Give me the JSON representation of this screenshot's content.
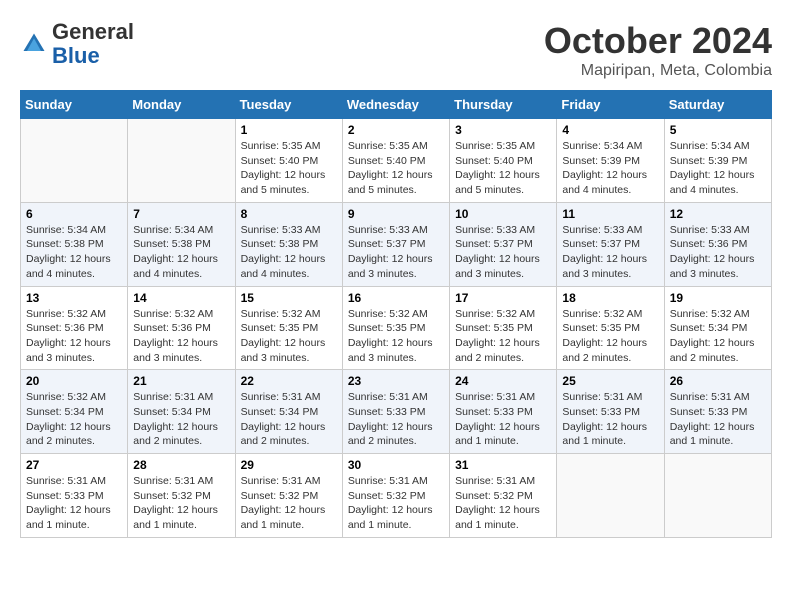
{
  "header": {
    "logo_general": "General",
    "logo_blue": "Blue",
    "month": "October 2024",
    "location": "Mapiripan, Meta, Colombia"
  },
  "days_of_week": [
    "Sunday",
    "Monday",
    "Tuesday",
    "Wednesday",
    "Thursday",
    "Friday",
    "Saturday"
  ],
  "weeks": [
    [
      {
        "day": "",
        "info": ""
      },
      {
        "day": "",
        "info": ""
      },
      {
        "day": "1",
        "info": "Sunrise: 5:35 AM\nSunset: 5:40 PM\nDaylight: 12 hours\nand 5 minutes."
      },
      {
        "day": "2",
        "info": "Sunrise: 5:35 AM\nSunset: 5:40 PM\nDaylight: 12 hours\nand 5 minutes."
      },
      {
        "day": "3",
        "info": "Sunrise: 5:35 AM\nSunset: 5:40 PM\nDaylight: 12 hours\nand 5 minutes."
      },
      {
        "day": "4",
        "info": "Sunrise: 5:34 AM\nSunset: 5:39 PM\nDaylight: 12 hours\nand 4 minutes."
      },
      {
        "day": "5",
        "info": "Sunrise: 5:34 AM\nSunset: 5:39 PM\nDaylight: 12 hours\nand 4 minutes."
      }
    ],
    [
      {
        "day": "6",
        "info": "Sunrise: 5:34 AM\nSunset: 5:38 PM\nDaylight: 12 hours\nand 4 minutes."
      },
      {
        "day": "7",
        "info": "Sunrise: 5:34 AM\nSunset: 5:38 PM\nDaylight: 12 hours\nand 4 minutes."
      },
      {
        "day": "8",
        "info": "Sunrise: 5:33 AM\nSunset: 5:38 PM\nDaylight: 12 hours\nand 4 minutes."
      },
      {
        "day": "9",
        "info": "Sunrise: 5:33 AM\nSunset: 5:37 PM\nDaylight: 12 hours\nand 3 minutes."
      },
      {
        "day": "10",
        "info": "Sunrise: 5:33 AM\nSunset: 5:37 PM\nDaylight: 12 hours\nand 3 minutes."
      },
      {
        "day": "11",
        "info": "Sunrise: 5:33 AM\nSunset: 5:37 PM\nDaylight: 12 hours\nand 3 minutes."
      },
      {
        "day": "12",
        "info": "Sunrise: 5:33 AM\nSunset: 5:36 PM\nDaylight: 12 hours\nand 3 minutes."
      }
    ],
    [
      {
        "day": "13",
        "info": "Sunrise: 5:32 AM\nSunset: 5:36 PM\nDaylight: 12 hours\nand 3 minutes."
      },
      {
        "day": "14",
        "info": "Sunrise: 5:32 AM\nSunset: 5:36 PM\nDaylight: 12 hours\nand 3 minutes."
      },
      {
        "day": "15",
        "info": "Sunrise: 5:32 AM\nSunset: 5:35 PM\nDaylight: 12 hours\nand 3 minutes."
      },
      {
        "day": "16",
        "info": "Sunrise: 5:32 AM\nSunset: 5:35 PM\nDaylight: 12 hours\nand 3 minutes."
      },
      {
        "day": "17",
        "info": "Sunrise: 5:32 AM\nSunset: 5:35 PM\nDaylight: 12 hours\nand 2 minutes."
      },
      {
        "day": "18",
        "info": "Sunrise: 5:32 AM\nSunset: 5:35 PM\nDaylight: 12 hours\nand 2 minutes."
      },
      {
        "day": "19",
        "info": "Sunrise: 5:32 AM\nSunset: 5:34 PM\nDaylight: 12 hours\nand 2 minutes."
      }
    ],
    [
      {
        "day": "20",
        "info": "Sunrise: 5:32 AM\nSunset: 5:34 PM\nDaylight: 12 hours\nand 2 minutes."
      },
      {
        "day": "21",
        "info": "Sunrise: 5:31 AM\nSunset: 5:34 PM\nDaylight: 12 hours\nand 2 minutes."
      },
      {
        "day": "22",
        "info": "Sunrise: 5:31 AM\nSunset: 5:34 PM\nDaylight: 12 hours\nand 2 minutes."
      },
      {
        "day": "23",
        "info": "Sunrise: 5:31 AM\nSunset: 5:33 PM\nDaylight: 12 hours\nand 2 minutes."
      },
      {
        "day": "24",
        "info": "Sunrise: 5:31 AM\nSunset: 5:33 PM\nDaylight: 12 hours\nand 1 minute."
      },
      {
        "day": "25",
        "info": "Sunrise: 5:31 AM\nSunset: 5:33 PM\nDaylight: 12 hours\nand 1 minute."
      },
      {
        "day": "26",
        "info": "Sunrise: 5:31 AM\nSunset: 5:33 PM\nDaylight: 12 hours\nand 1 minute."
      }
    ],
    [
      {
        "day": "27",
        "info": "Sunrise: 5:31 AM\nSunset: 5:33 PM\nDaylight: 12 hours\nand 1 minute."
      },
      {
        "day": "28",
        "info": "Sunrise: 5:31 AM\nSunset: 5:32 PM\nDaylight: 12 hours\nand 1 minute."
      },
      {
        "day": "29",
        "info": "Sunrise: 5:31 AM\nSunset: 5:32 PM\nDaylight: 12 hours\nand 1 minute."
      },
      {
        "day": "30",
        "info": "Sunrise: 5:31 AM\nSunset: 5:32 PM\nDaylight: 12 hours\nand 1 minute."
      },
      {
        "day": "31",
        "info": "Sunrise: 5:31 AM\nSunset: 5:32 PM\nDaylight: 12 hours\nand 1 minute."
      },
      {
        "day": "",
        "info": ""
      },
      {
        "day": "",
        "info": ""
      }
    ]
  ],
  "colors": {
    "header_bg": "#2472b3",
    "accent": "#1a5fa8"
  }
}
